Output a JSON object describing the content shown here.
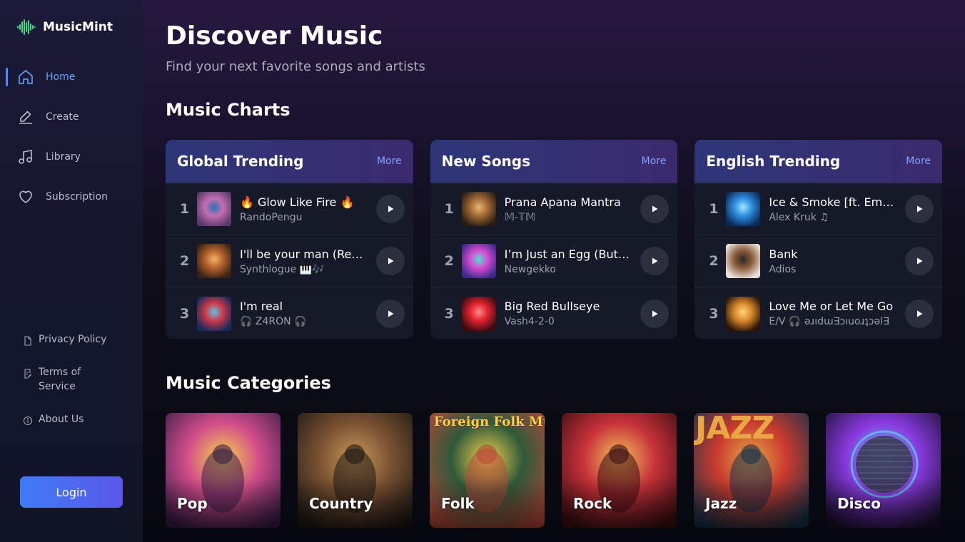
{
  "app": {
    "name": "MusicMint"
  },
  "sidebar": {
    "nav": [
      {
        "label": "Home",
        "icon": "home-icon",
        "active": true
      },
      {
        "label": "Create",
        "icon": "pencil-icon",
        "active": false
      },
      {
        "label": "Library",
        "icon": "music-note-icon",
        "active": false
      },
      {
        "label": "Subscription",
        "icon": "heart-icon",
        "active": false
      }
    ],
    "footer": [
      {
        "label": "Privacy Policy",
        "icon": "document-icon"
      },
      {
        "label": "Terms of Service",
        "icon": "document-edit-icon"
      },
      {
        "label": "About Us",
        "icon": "info-icon"
      }
    ],
    "login_label": "Login"
  },
  "header": {
    "title": "Discover Music",
    "subtitle": "Find your next favorite songs and artists"
  },
  "charts_section": {
    "title": "Music Charts",
    "more_label": "More",
    "charts": [
      {
        "name": "Global Trending",
        "tracks": [
          {
            "rank": "1",
            "title": "🔥 Glow Like Fire 🔥",
            "artist": "RandoPengu",
            "cover_colors": [
              "#5a3a6e",
              "#c46fb0",
              "#2a6fb8"
            ]
          },
          {
            "rank": "2",
            "title": "I'll be your man (Remix)",
            "artist": "Synthlogue 🎹🎶",
            "cover_colors": [
              "#3a2214",
              "#b5632c",
              "#f2b36a"
            ]
          },
          {
            "rank": "3",
            "title": "I'm real",
            "artist": "🎧 Z4RON 🎧",
            "cover_colors": [
              "#182a5a",
              "#d03a4a",
              "#5fc0e6"
            ]
          }
        ]
      },
      {
        "name": "New Songs",
        "tracks": [
          {
            "rank": "1",
            "title": "Prana Apana Mantra",
            "artist": "𝕄-𝕋𝕄",
            "cover_colors": [
              "#2a1e14",
              "#a36a36",
              "#e8b66e"
            ]
          },
          {
            "rank": "2",
            "title": "I’m Just an Egg (But I Dream)",
            "artist": "Newgekko",
            "cover_colors": [
              "#3e2a8e",
              "#d84ad0",
              "#4fe0d8"
            ]
          },
          {
            "rank": "3",
            "title": "Big Red Bullseye",
            "artist": "Vash4-2-0",
            "cover_colors": [
              "#3a0a10",
              "#e0232e",
              "#ff8a8a"
            ]
          }
        ]
      },
      {
        "name": "English Trending",
        "tracks": [
          {
            "rank": "1",
            "title": "Ice & Smoke [ft. Emily]",
            "artist": "Alex Kruk ♫",
            "cover_colors": [
              "#0a2a5a",
              "#2f8ee0",
              "#9fe6ff"
            ]
          },
          {
            "rank": "2",
            "title": "Bank",
            "artist": "Adios",
            "cover_colors": [
              "#e8e2d8",
              "#8a5a3a",
              "#2a2a2a"
            ]
          },
          {
            "rank": "3",
            "title": "Love Me or Let Me Go",
            "artist": "E/V 🎧 ǝɹıdɯ∃ɔıuoɹʇɔǝl∃",
            "cover_colors": [
              "#2a1608",
              "#d9892a",
              "#ffd27a"
            ]
          }
        ]
      }
    ]
  },
  "categories_section": {
    "title": "Music Categories",
    "banners": {
      "folk": "Foreign Folk Music",
      "jazz": "JAZZ"
    },
    "categories": [
      {
        "label": "Pop",
        "icon": "pop-concert-image",
        "colors": [
          "#3a1d4a",
          "#d24e8a",
          "#f6d34a"
        ]
      },
      {
        "label": "Country",
        "icon": "country-guitarist-image",
        "colors": [
          "#1d1814",
          "#7a5232",
          "#c89a5a"
        ]
      },
      {
        "label": "Folk",
        "icon": "folk-band-image",
        "colors": [
          "#b8483a",
          "#2f5a3a",
          "#f3d34a"
        ]
      },
      {
        "label": "Rock",
        "icon": "rock-drummer-image",
        "colors": [
          "#3a0e12",
          "#c8323a",
          "#f2c25a"
        ]
      },
      {
        "label": "Jazz",
        "icon": "jazz-musicians-image",
        "colors": [
          "#15324a",
          "#c83a2e",
          "#e8a645"
        ]
      },
      {
        "label": "Disco",
        "icon": "disco-ball-image",
        "colors": [
          "#1a1030",
          "#8a3ae0",
          "#5ac8f0"
        ]
      }
    ]
  },
  "colors": {
    "accent": "#4b8bff",
    "sidebar_bg": "#1b1a38",
    "main_bg_top": "#27183f",
    "card_bg": "#161a28"
  }
}
